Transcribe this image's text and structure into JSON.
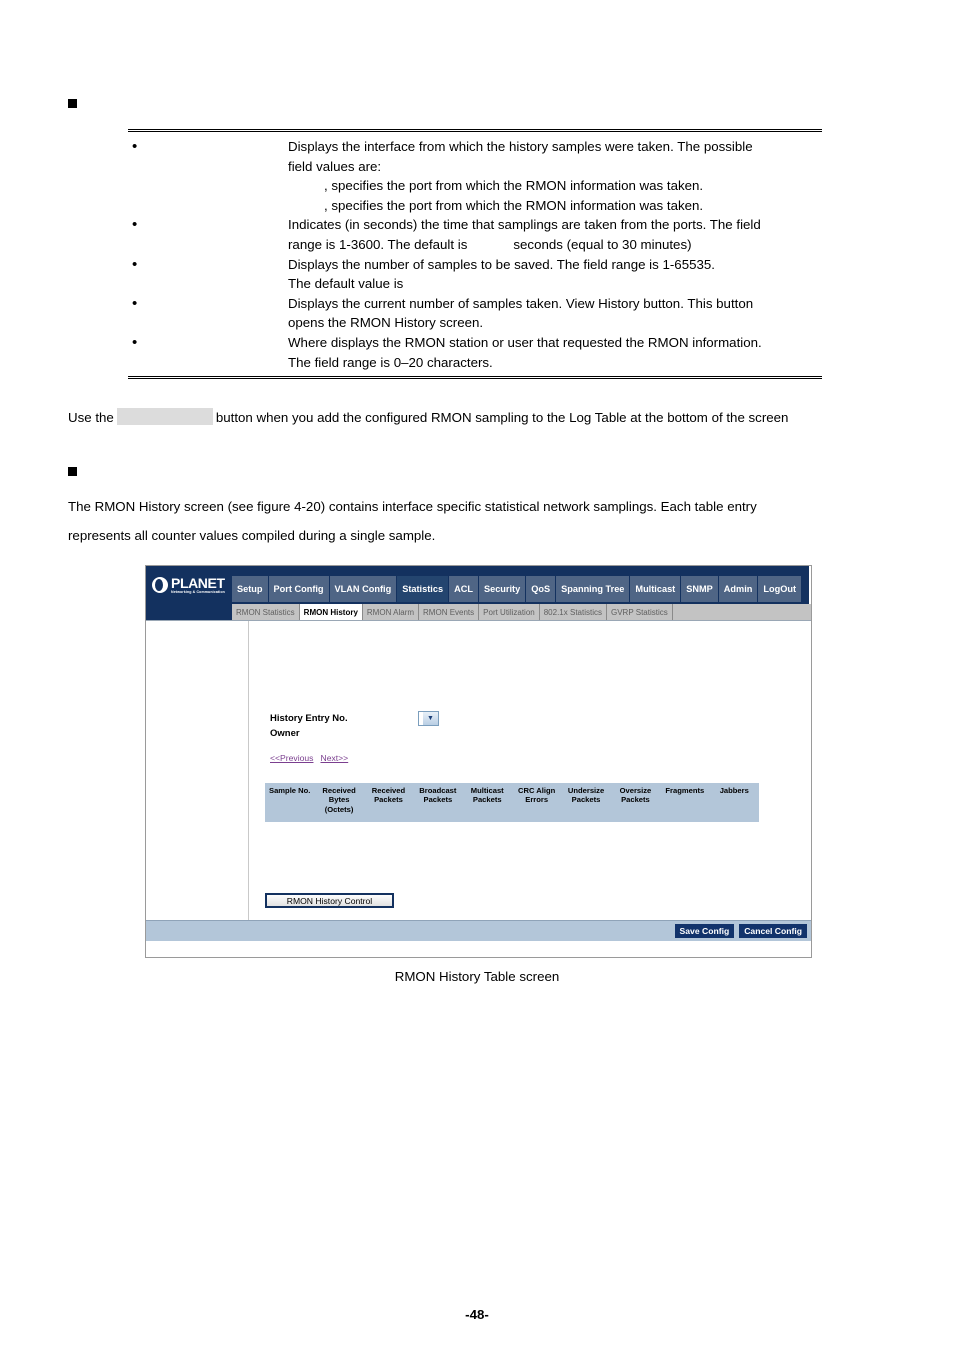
{
  "document": {
    "page_number": "-48-",
    "figure_caption": "RMON History Table screen"
  },
  "definition_table": {
    "rows": [
      {
        "term": "",
        "lines": [
          {
            "text": "Displays the interface from which the history samples were taken. The possible",
            "indent": false
          },
          {
            "text": "field values are:",
            "indent": false
          },
          {
            "text": ", specifies the port from which the RMON information was taken.",
            "indent": true
          },
          {
            "text": ", specifies the port from which the RMON information was taken.",
            "indent": true
          }
        ]
      },
      {
        "term": "",
        "lines": [
          {
            "text": "Indicates (in seconds) the time that samplings are taken from the ports. The field",
            "indent": false
          },
          {
            "text": "range is 1-3600. The default is",
            "indent": false,
            "blank_after": "seconds (equal to 30 minutes)"
          }
        ]
      },
      {
        "term": "",
        "lines": [
          {
            "text": "Displays the number of samples to be saved. The field range is 1-65535.",
            "indent": false
          },
          {
            "text": "The default value is",
            "indent": false
          }
        ]
      },
      {
        "term": "",
        "lines": [
          {
            "text": "Displays the current number of samples taken. View History button. This button",
            "indent": false
          },
          {
            "text": "opens the RMON History screen.",
            "indent": false
          }
        ]
      },
      {
        "term": "",
        "lines": [
          {
            "text": "Where displays the RMON station or user that requested the RMON information.",
            "indent": false
          },
          {
            "text": "The field range is 0–20 characters.",
            "indent": false
          }
        ]
      }
    ]
  },
  "paragraphs": {
    "use_button_prefix": "Use the",
    "use_button_suffix": "button when you add the configured RMON sampling to the Log Table at the bottom of the screen",
    "history_intro_line1": "The RMON History screen (see figure 4-20) contains interface specific statistical network samplings. Each table entry",
    "history_intro_line2": "represents all counter values compiled during a single sample."
  },
  "app": {
    "logo": {
      "name": "PLANET",
      "tagline": "Networking & Communication"
    },
    "nav": [
      {
        "label": "Setup",
        "active": false
      },
      {
        "label": "Port Config",
        "active": false
      },
      {
        "label": "VLAN Config",
        "active": false
      },
      {
        "label": "Statistics",
        "active": true
      },
      {
        "label": "ACL",
        "active": false
      },
      {
        "label": "Security",
        "active": false
      },
      {
        "label": "QoS",
        "active": false
      },
      {
        "label": "Spanning Tree",
        "active": false
      },
      {
        "label": "Multicast",
        "active": false
      },
      {
        "label": "SNMP",
        "active": false
      },
      {
        "label": "Admin",
        "active": false
      },
      {
        "label": "LogOut",
        "active": false
      }
    ],
    "subnav": [
      {
        "label": "RMON Statistics",
        "active": false
      },
      {
        "label": "RMON History",
        "active": true
      },
      {
        "label": "RMON Alarm",
        "active": false
      },
      {
        "label": "RMON Events",
        "active": false
      },
      {
        "label": "Port Utilization",
        "active": false
      },
      {
        "label": "802.1x Statistics",
        "active": false
      },
      {
        "label": "GVRP Statistics",
        "active": false
      }
    ],
    "form": {
      "history_entry_label": "History Entry No.",
      "history_entry_value": "",
      "owner_label": "Owner",
      "owner_value": "",
      "dropdown_icon": "chevron-down-icon"
    },
    "pager": {
      "previous": "<<Previous",
      "next": "Next>>"
    },
    "table": {
      "columns": [
        "Sample No.",
        "Received Bytes (Octets)",
        "Received Packets",
        "Broadcast Packets",
        "Multicast Packets",
        "CRC Align Errors",
        "Undersize Packets",
        "Oversize Packets",
        "Fragments",
        "Jabbers"
      ],
      "rows": []
    },
    "buttons": {
      "history_control": "RMON History Control",
      "save_config": "Save Config",
      "cancel_config": "Cancel Config"
    },
    "colors": {
      "nav_navy": "#13315f",
      "nav_item": "#4f6585",
      "nav_active": "#24456f",
      "subnav_gray": "#c3c3c3",
      "table_header": "#b3c6d9",
      "button_navy": "#12336b",
      "link_purple": "#7b3f8f"
    }
  }
}
